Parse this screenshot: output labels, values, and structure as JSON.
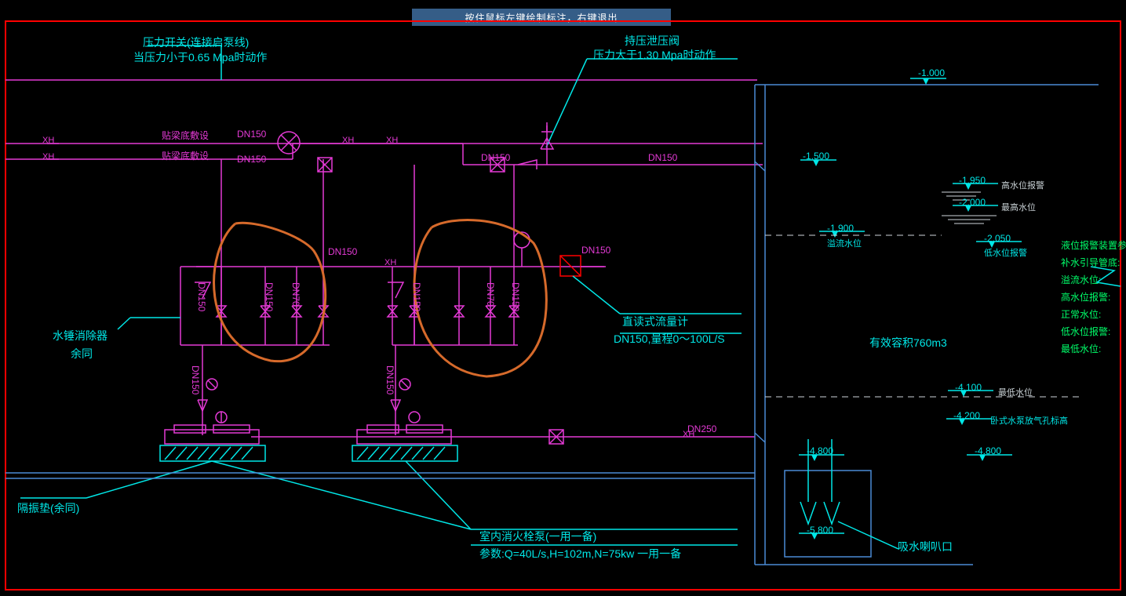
{
  "banner": "按住鼠标左键绘制标注，右键退出",
  "labels": {
    "pressureSwitch1": "压力开关(连接启泵线)",
    "pressureSwitch2": "当压力小于0.65 Mpa时动作",
    "reliefValve1": "持压泄压阀",
    "reliefValve2": "压力大于1.30 Mpa时动作",
    "hammer1": "水锤消除器",
    "hammer2": "余同",
    "flowmeter1": "直读式流量计",
    "flowmeter2": "DN150,量程0～100L/S",
    "volume": "有效容积760m3",
    "pump1": "室内消火栓泵(一用一备)",
    "pump2": "参数:Q=40L/s,H=102m,N=75kw 一用一备",
    "pad": "隔振垫(余同)",
    "suction": "吸水喇叭口",
    "beam1": "贴梁底敷设",
    "beam2": "贴梁底敷设"
  },
  "pipes": {
    "dn150_a": "DN150",
    "dn150_b": "DN150",
    "dn150_c": "DN150",
    "dn150_d": "DN150",
    "dn150_e": "DN150",
    "dn150_f": "DN150",
    "dn150_g": "DN150",
    "dn70_a": "DN70",
    "dn70_b": "DN70",
    "dn150_v1": "DN150",
    "dn150_v2": "DN150",
    "dn150_v3": "DN150",
    "dn150_v4": "DN150",
    "dn150_v5": "DN150",
    "dn250": "DN250"
  },
  "levels": {
    "l1": "-1.000",
    "l15": "-1.500",
    "l19": "-1.900",
    "l195": "-1.950",
    "l20": "-2.000",
    "l205": "-2.050",
    "l41": "-4.100",
    "l42": "-4.200",
    "l48a": "-4.800",
    "l48b": "-4.800",
    "l58": "-5.800"
  },
  "levelsNotes": {
    "hi_alarm": "高水位报警",
    "max": "最高水位",
    "overflow": "溢流水位",
    "low_alarm": "低水位报警",
    "min": "最低水位",
    "vent": "卧式水泵放气孔标高"
  },
  "rightParams": {
    "title": "液位报警装置参数:",
    "p1": "补水引导管底:",
    "p2": "溢流水位:",
    "p3": "高水位报警:",
    "p4": "正常水位:",
    "p5": "低水位报警:",
    "p6": "最低水位:"
  }
}
